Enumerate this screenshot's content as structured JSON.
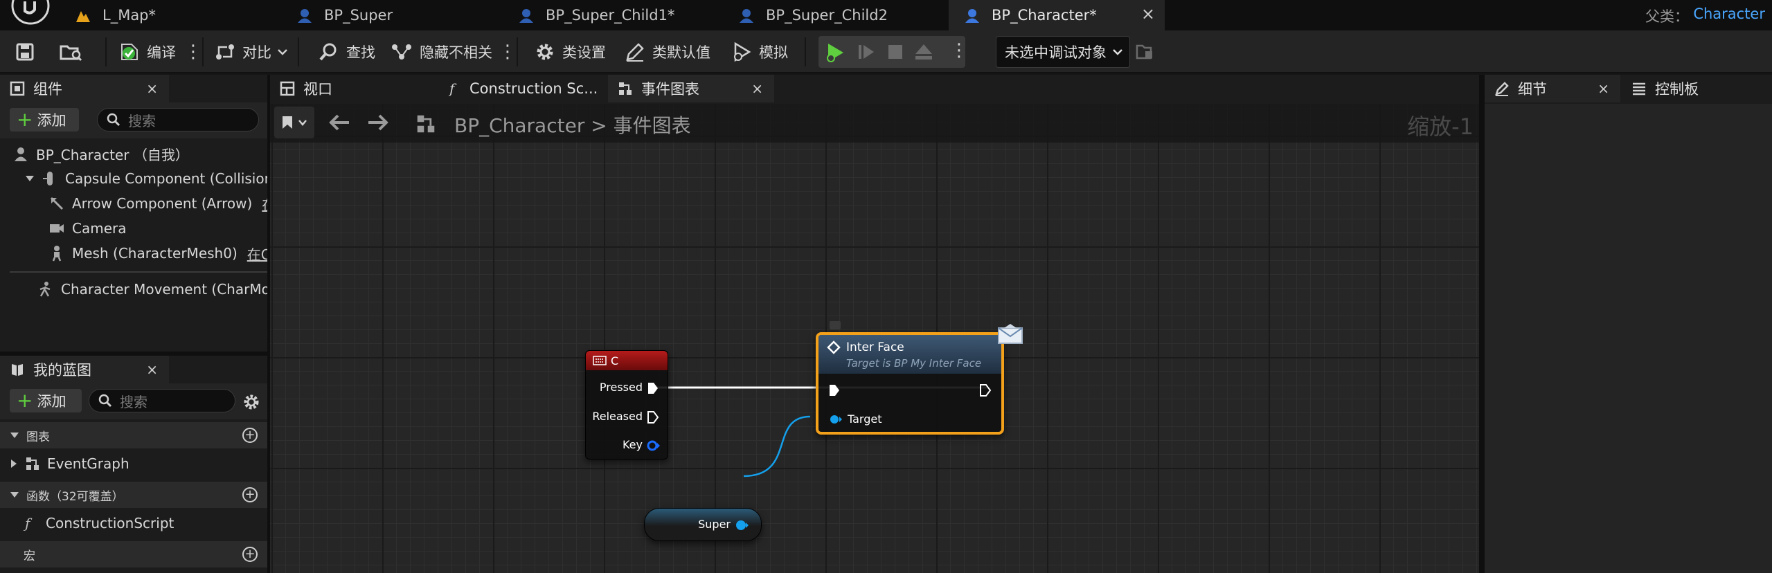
{
  "tabs": [
    {
      "label": "L_Map*",
      "active": false
    },
    {
      "label": "BP_Super",
      "active": false
    },
    {
      "label": "BP_Super_Child1*",
      "active": false
    },
    {
      "label": "BP_Super_Child2",
      "active": false
    },
    {
      "label": "BP_Character*",
      "active": true
    }
  ],
  "tab_close": "×",
  "parent_class": {
    "label": "父类：",
    "value": "Character"
  },
  "toolbar": {
    "compile": "编译",
    "diff": "对比",
    "find": "查找",
    "hide_unrelated": "隐藏不相关",
    "class_settings": "类设置",
    "class_defaults": "类默认值",
    "simulate": "模拟",
    "debug_object": "未选中调试对象"
  },
  "components_panel": {
    "title": "组件",
    "add_label": "添加",
    "search_placeholder": "搜索",
    "items": [
      {
        "label": "BP_Character （自我）",
        "extra": ""
      },
      {
        "label": "Capsule Component (CollisionCy",
        "extra": ""
      },
      {
        "label": "Arrow Component (Arrow)",
        "extra": "在C"
      },
      {
        "label": "Camera",
        "extra": ""
      },
      {
        "label": "Mesh (CharacterMesh0)",
        "extra": "在C++"
      },
      {
        "label": "Character Movement (CharMove",
        "extra": ""
      }
    ]
  },
  "mybp_panel": {
    "title": "我的蓝图",
    "add_label": "添加",
    "search_placeholder": "搜索",
    "sections": {
      "graphs": "图表",
      "event_graph": "EventGraph",
      "functions": "函数（32可覆盖）",
      "construction_script": "ConstructionScript",
      "macros": "宏"
    }
  },
  "graph_tabs": [
    {
      "label": "视口"
    },
    {
      "label": "Construction Sc..."
    },
    {
      "label": "事件图表"
    }
  ],
  "breadcrumb": {
    "root": "BP_Character",
    "sep": ">",
    "current": "事件图表"
  },
  "zoom_label": "缩放-1",
  "right_panels": {
    "details": "细节",
    "palette": "控制板"
  },
  "nodes": {
    "key_event": {
      "title": "C",
      "pins": [
        "Pressed",
        "Released",
        "Key"
      ]
    },
    "interface_call": {
      "title": "Inter Face",
      "subtitle": "Target is BP My Inter Face",
      "target_pin": "Target"
    },
    "super_var": {
      "label": "Super"
    }
  },
  "colors": {
    "accent_blue": "#4aa7ff",
    "selection_orange": "#f3a01a",
    "key_event_header": "#9a1414",
    "object_pin": "#14a0ec",
    "play_green": "#5fcf3f"
  }
}
